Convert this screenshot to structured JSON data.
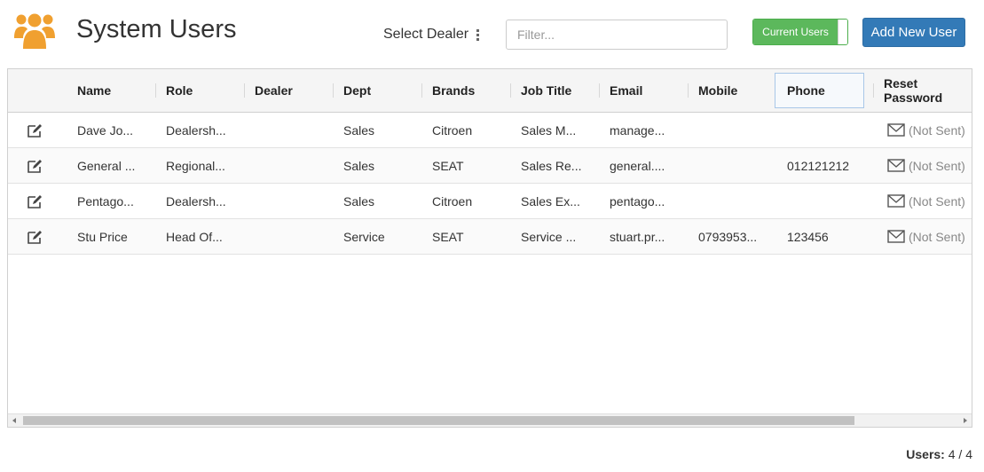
{
  "header": {
    "title": "System Users",
    "icon": "users-icon",
    "icon_color": "#f0a030"
  },
  "toolbar": {
    "dealer_label": "Select Dealer",
    "filter_placeholder": "Filter...",
    "filter_value": "",
    "toggle_label": "Current Users",
    "toggle_color": "#5cb85c",
    "add_label": "Add New User",
    "add_color": "#337ab7"
  },
  "table": {
    "columns": [
      "Name",
      "Role",
      "Dealer",
      "Dept",
      "Brands",
      "Job Title",
      "Email",
      "Mobile",
      "Phone",
      "Reset Password"
    ],
    "rows": [
      {
        "name": "Dave Jo...",
        "role": "Dealersh...",
        "dealer": "",
        "dept": "Sales",
        "brands": "Citroen",
        "job_title": "Sales M...",
        "email": "manage...",
        "mobile": "",
        "phone": "",
        "reset": "(Not Sent)"
      },
      {
        "name": "General ...",
        "role": "Regional...",
        "dealer": "",
        "dept": "Sales",
        "brands": "SEAT",
        "job_title": "Sales Re...",
        "email": "general....",
        "mobile": "",
        "phone": "012121212",
        "reset": "(Not Sent)"
      },
      {
        "name": "Pentago...",
        "role": "Dealersh...",
        "dealer": "",
        "dept": "Sales",
        "brands": "Citroen",
        "job_title": "Sales Ex...",
        "email": "pentago...",
        "mobile": "",
        "phone": "",
        "reset": "(Not Sent)"
      },
      {
        "name": "Stu Price",
        "role": "Head Of...",
        "dealer": "",
        "dept": "Service",
        "brands": "SEAT",
        "job_title": "Service ...",
        "email": "stuart.pr...",
        "mobile": "0793953...",
        "phone": "123456",
        "reset": "(Not Sent)"
      }
    ]
  },
  "footer": {
    "count_label": "Users:",
    "count_value": "4 / 4"
  }
}
